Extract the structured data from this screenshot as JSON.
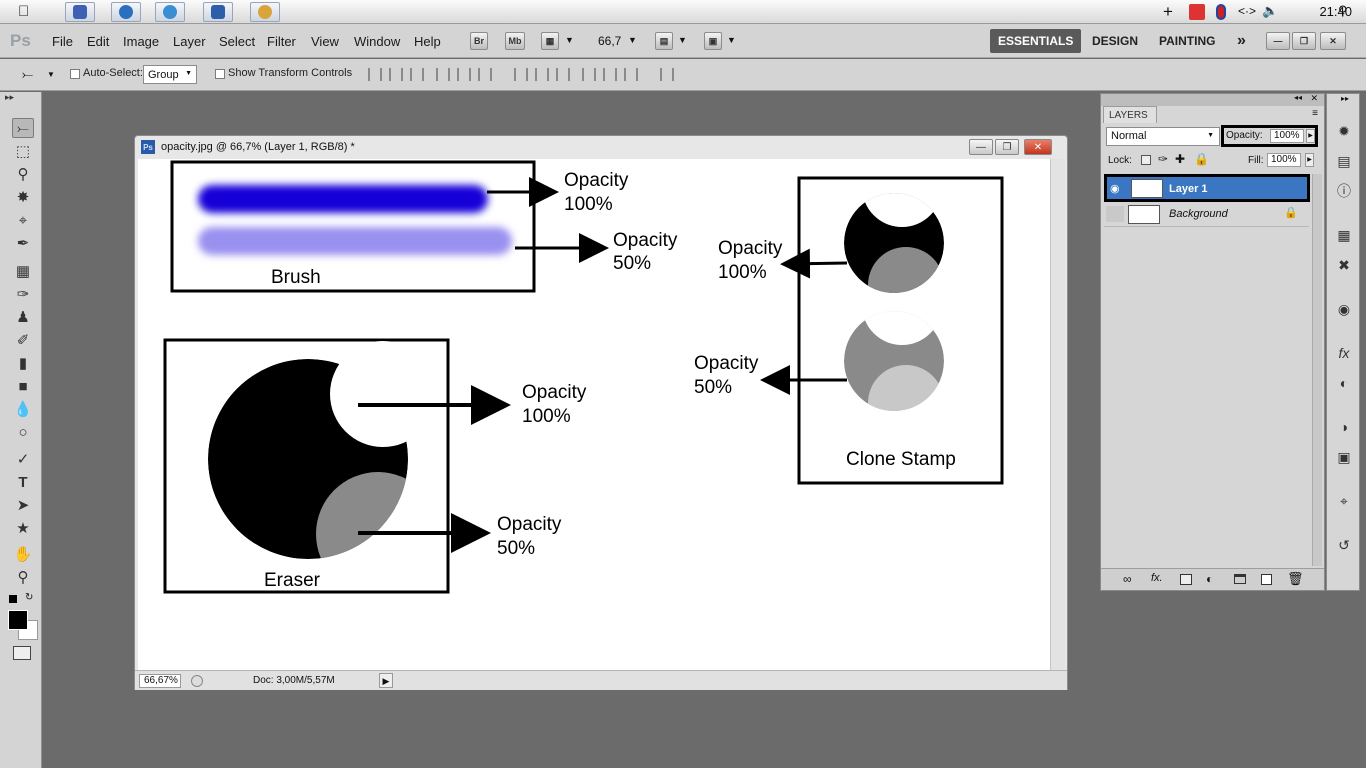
{
  "system_bar": {
    "clock": "21:40",
    "apple_icon": "apple-icon",
    "tray_icons": [
      "plus-icon",
      "antivirus-icon",
      "record-icon",
      "network-icon",
      "volume-icon",
      "search-icon"
    ]
  },
  "app": {
    "logo": "Ps",
    "menu": [
      "File",
      "Edit",
      "Image",
      "Layer",
      "Select",
      "Filter",
      "View",
      "Window",
      "Help"
    ],
    "bridge_btn": "Br",
    "minibridge_btn": "Mb",
    "zoom_level": "66,7",
    "workspaces": [
      "ESSENTIALS",
      "DESIGN",
      "PAINTING"
    ],
    "workspace_more": "»"
  },
  "options_bar": {
    "auto_select_label": "Auto-Select:",
    "auto_select_value": "Group",
    "transform_label": "Show Transform Controls"
  },
  "document": {
    "title": "opacity.jpg @ 66,7% (Layer 1, RGB/8) *",
    "zoom": "66,67%",
    "info": "Doc: 3,00M/5,57M"
  },
  "canvas_labels": {
    "brush": "Brush",
    "eraser": "Eraser",
    "clone": "Clone Stamp",
    "opacity_word": "Opacity",
    "pct_100": "100%",
    "pct_50": "50%"
  },
  "layers_panel": {
    "tab": "LAYERS",
    "blend_mode": "Normal",
    "opacity_label": "Opacity:",
    "opacity_value": "100%",
    "lock_label": "Lock:",
    "fill_label": "Fill:",
    "fill_value": "100%",
    "layers": [
      {
        "name": "Layer 1",
        "selected": true,
        "visible": true
      },
      {
        "name": "Background",
        "selected": false,
        "visible": false,
        "locked": true
      }
    ]
  },
  "colors": {
    "selection_blue": "#3b76c2",
    "brush_100": "#1500d8",
    "brush_50": "#9a90f0"
  }
}
